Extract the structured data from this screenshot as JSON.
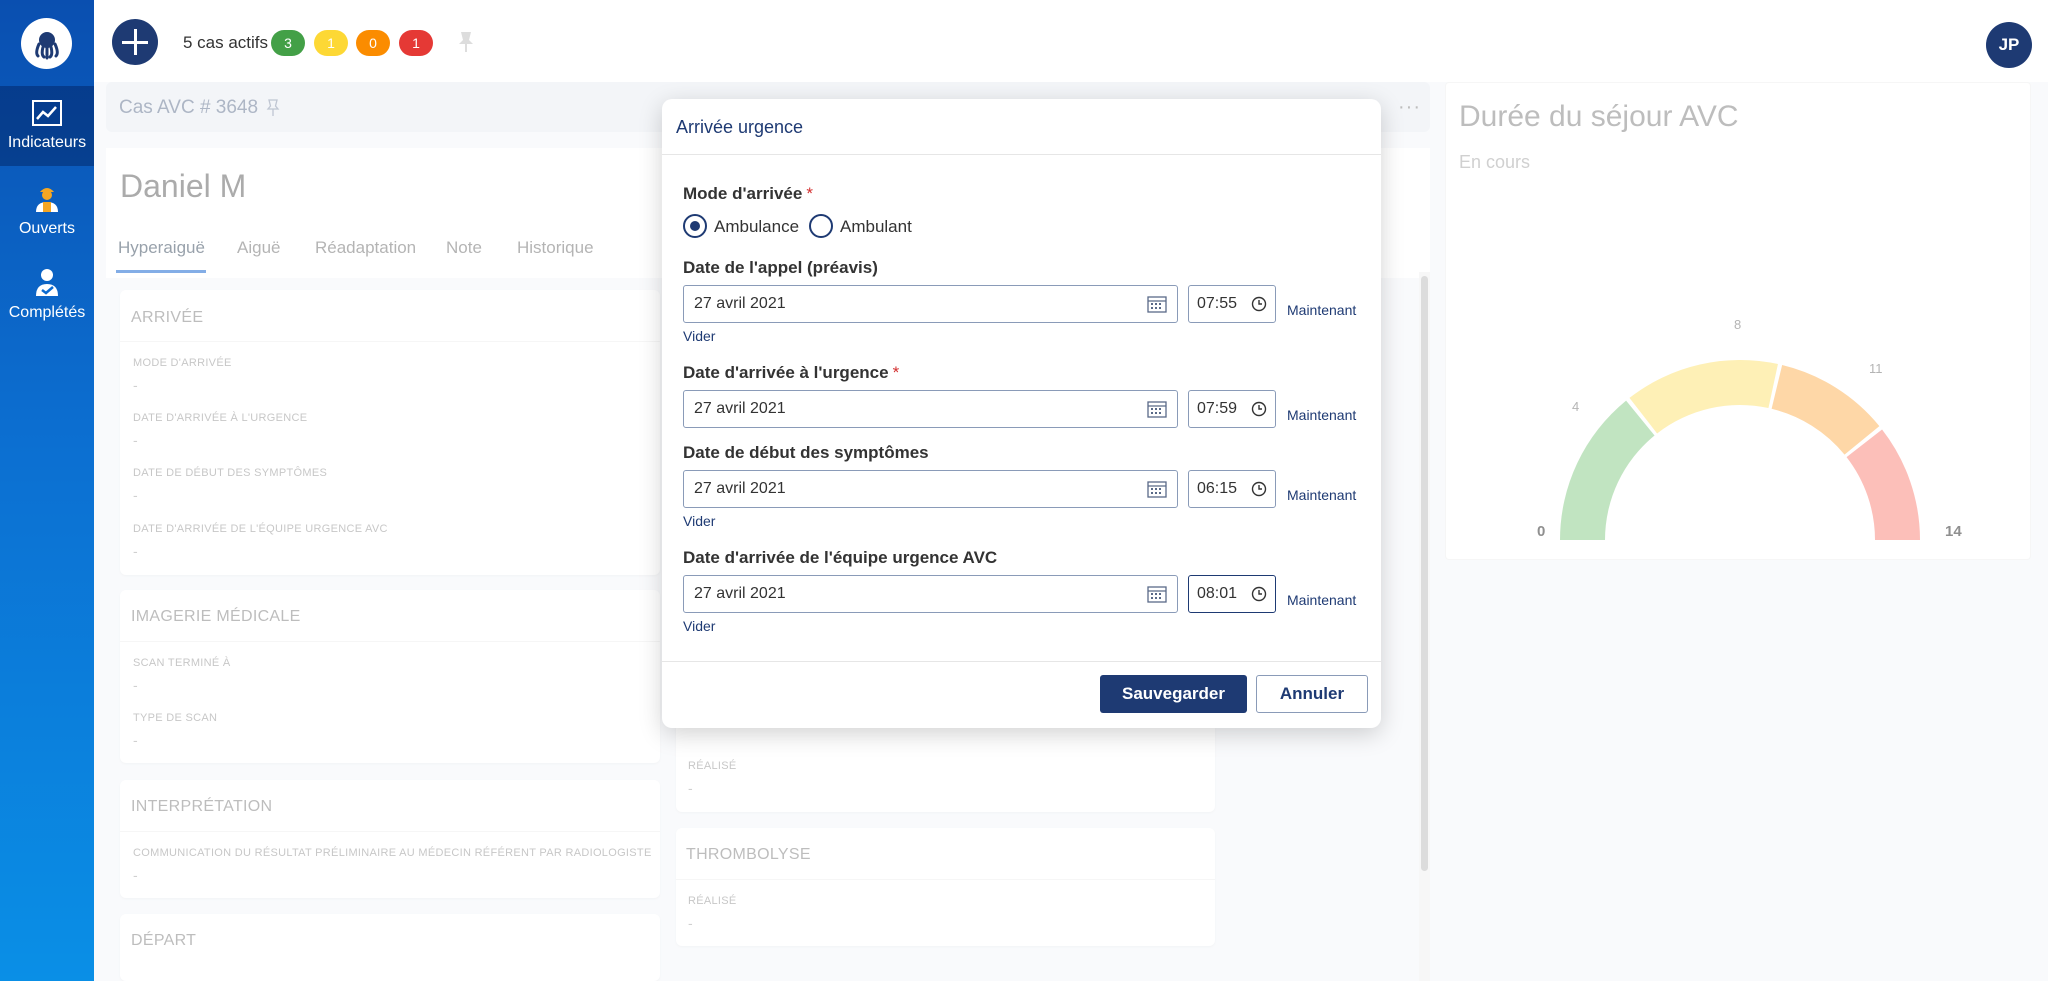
{
  "sidebar": {
    "items": [
      {
        "label": "Indicateurs",
        "icon": "chart-icon"
      },
      {
        "label": "Ouverts",
        "icon": "user-hardhat-icon"
      },
      {
        "label": "Complétés",
        "icon": "user-check-icon"
      }
    ]
  },
  "topbar": {
    "cases_label": "5 cas actifs",
    "pills": [
      {
        "count": "3",
        "color": "#43a047"
      },
      {
        "count": "1",
        "color": "#fdd835"
      },
      {
        "count": "0",
        "color": "#fb8c00"
      },
      {
        "count": "1",
        "color": "#e53935"
      }
    ],
    "avatar_initials": "JP"
  },
  "case": {
    "title": "Cas AVC # 3648",
    "patient_name": "Daniel M",
    "tabs": [
      "Hyperaiguë",
      "Aiguë",
      "Réadaptation",
      "Note",
      "Historique"
    ]
  },
  "panels": {
    "arrivee": {
      "title": "ARRIVÉE",
      "fields": [
        {
          "label": "MODE D'ARRIVÉE",
          "value": "-"
        },
        {
          "label": "DATE D'ARRIVÉE À L'URGENCE",
          "value": "-"
        },
        {
          "label": "DATE DE DÉBUT DES SYMPTÔMES",
          "value": "-"
        },
        {
          "label": "DATE D'ARRIVÉE DE L'ÉQUIPE URGENCE AVC",
          "value": "-"
        }
      ]
    },
    "imagerie": {
      "title": "IMAGERIE MÉDICALE",
      "fields": [
        {
          "label": "SCAN TERMINÉ À",
          "value": "-"
        },
        {
          "label": "TYPE DE SCAN",
          "value": "-"
        }
      ]
    },
    "interpretation": {
      "title": "INTERPRÉTATION",
      "fields": [
        {
          "label": "COMMUNICATION DU RÉSULTAT PRÉLIMINAIRE AU MÉDECIN RÉFÉRENT PAR RADIOLOGISTE",
          "value": "-"
        }
      ]
    },
    "depart": {
      "title": "DÉPART"
    },
    "realise_mid": {
      "label": "RÉALISÉ",
      "value": "-"
    },
    "thrombolyse": {
      "title": "THROMBOLYSE",
      "fields": [
        {
          "label": "RÉALISÉ",
          "value": "-"
        }
      ]
    }
  },
  "gauge": {
    "title": "Durée du séjour AVC",
    "subtitle": "En cours",
    "min_label": "0",
    "max_label": "14",
    "tick_labels": [
      "4",
      "8",
      "11"
    ],
    "segments": [
      {
        "from": 0,
        "to": 4,
        "color": "#8fce8f"
      },
      {
        "from": 4,
        "to": 8,
        "color": "#fde37a"
      },
      {
        "from": 8,
        "to": 11,
        "color": "#fdb65f"
      },
      {
        "from": 11,
        "to": 14,
        "color": "#f98a80"
      }
    ],
    "min": 0,
    "max": 14
  },
  "modal": {
    "title": "Arrivée urgence",
    "mode_label": "Mode d'arrivée",
    "required_mark": "*",
    "options": [
      "Ambulance",
      "Ambulant"
    ],
    "selected": "Ambulance",
    "groups": [
      {
        "label": "Date de l'appel (préavis)",
        "required": false,
        "date": "27 avril 2021",
        "time": "07:55",
        "clear": "Vider"
      },
      {
        "label": "Date d'arrivée à l'urgence",
        "required": true,
        "date": "27 avril 2021",
        "time": "07:59",
        "clear": ""
      },
      {
        "label": "Date de début des symptômes",
        "required": false,
        "date": "27 avril 2021",
        "time": "06:15",
        "clear": "Vider"
      },
      {
        "label": "Date d'arrivée de l'équipe urgence AVC",
        "required": false,
        "date": "27 avril 2021",
        "time": "08:01",
        "clear": "Vider"
      }
    ],
    "now_label": "Maintenant",
    "save_label": "Sauvegarder",
    "cancel_label": "Annuler"
  }
}
